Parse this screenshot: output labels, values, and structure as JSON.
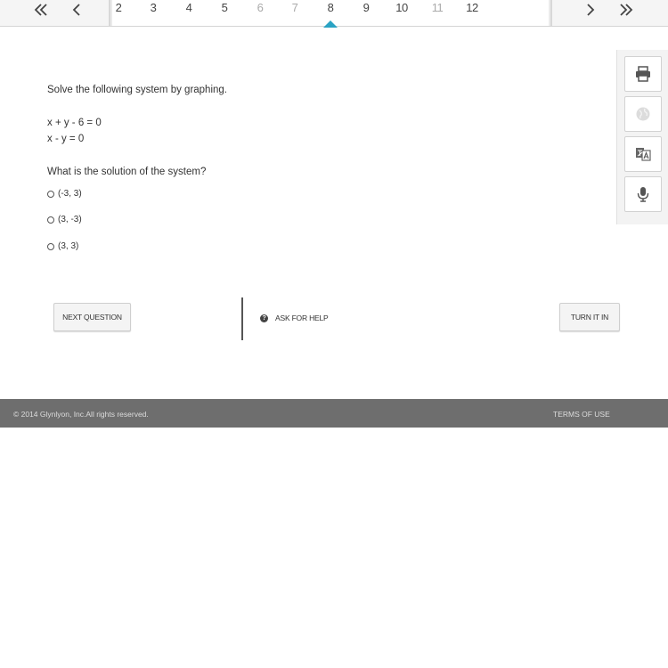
{
  "nav": {
    "pages": [
      {
        "label": "2",
        "dim": false
      },
      {
        "label": "3",
        "dim": false
      },
      {
        "label": "4",
        "dim": false
      },
      {
        "label": "5",
        "dim": false
      },
      {
        "label": "6",
        "dim": true
      },
      {
        "label": "7",
        "dim": true
      },
      {
        "label": "8",
        "dim": false
      },
      {
        "label": "9",
        "dim": false
      },
      {
        "label": "10",
        "dim": false
      },
      {
        "label": "11",
        "dim": true
      },
      {
        "label": "12",
        "dim": false
      }
    ],
    "current_page": "8",
    "icons": [
      "double-chevron-left-icon",
      "chevron-left-icon",
      "chevron-right-icon",
      "double-chevron-right-icon"
    ],
    "accent_color": "#2aa3c4"
  },
  "question": {
    "prompt": "Solve the following system by graphing.",
    "equation1": "x + y - 6 = 0",
    "equation2": "x - y = 0",
    "ask": "What is the solution of the system?",
    "choices": [
      {
        "label": "(-3, 3)"
      },
      {
        "label": "(3, -3)"
      },
      {
        "label": "(3, 3)"
      }
    ]
  },
  "tools": {
    "icons": [
      "print-icon",
      "globe-icon",
      "translate-icon",
      "microphone-icon"
    ]
  },
  "actions": {
    "next_label": "NEXT QUESTION",
    "help_label": "ASK FOR HELP",
    "turn_in_label": "TURN IT IN"
  },
  "footer": {
    "copyright": "© 2014 Glynlyon, Inc.All rights reserved.",
    "terms": "TERMS OF USE"
  }
}
